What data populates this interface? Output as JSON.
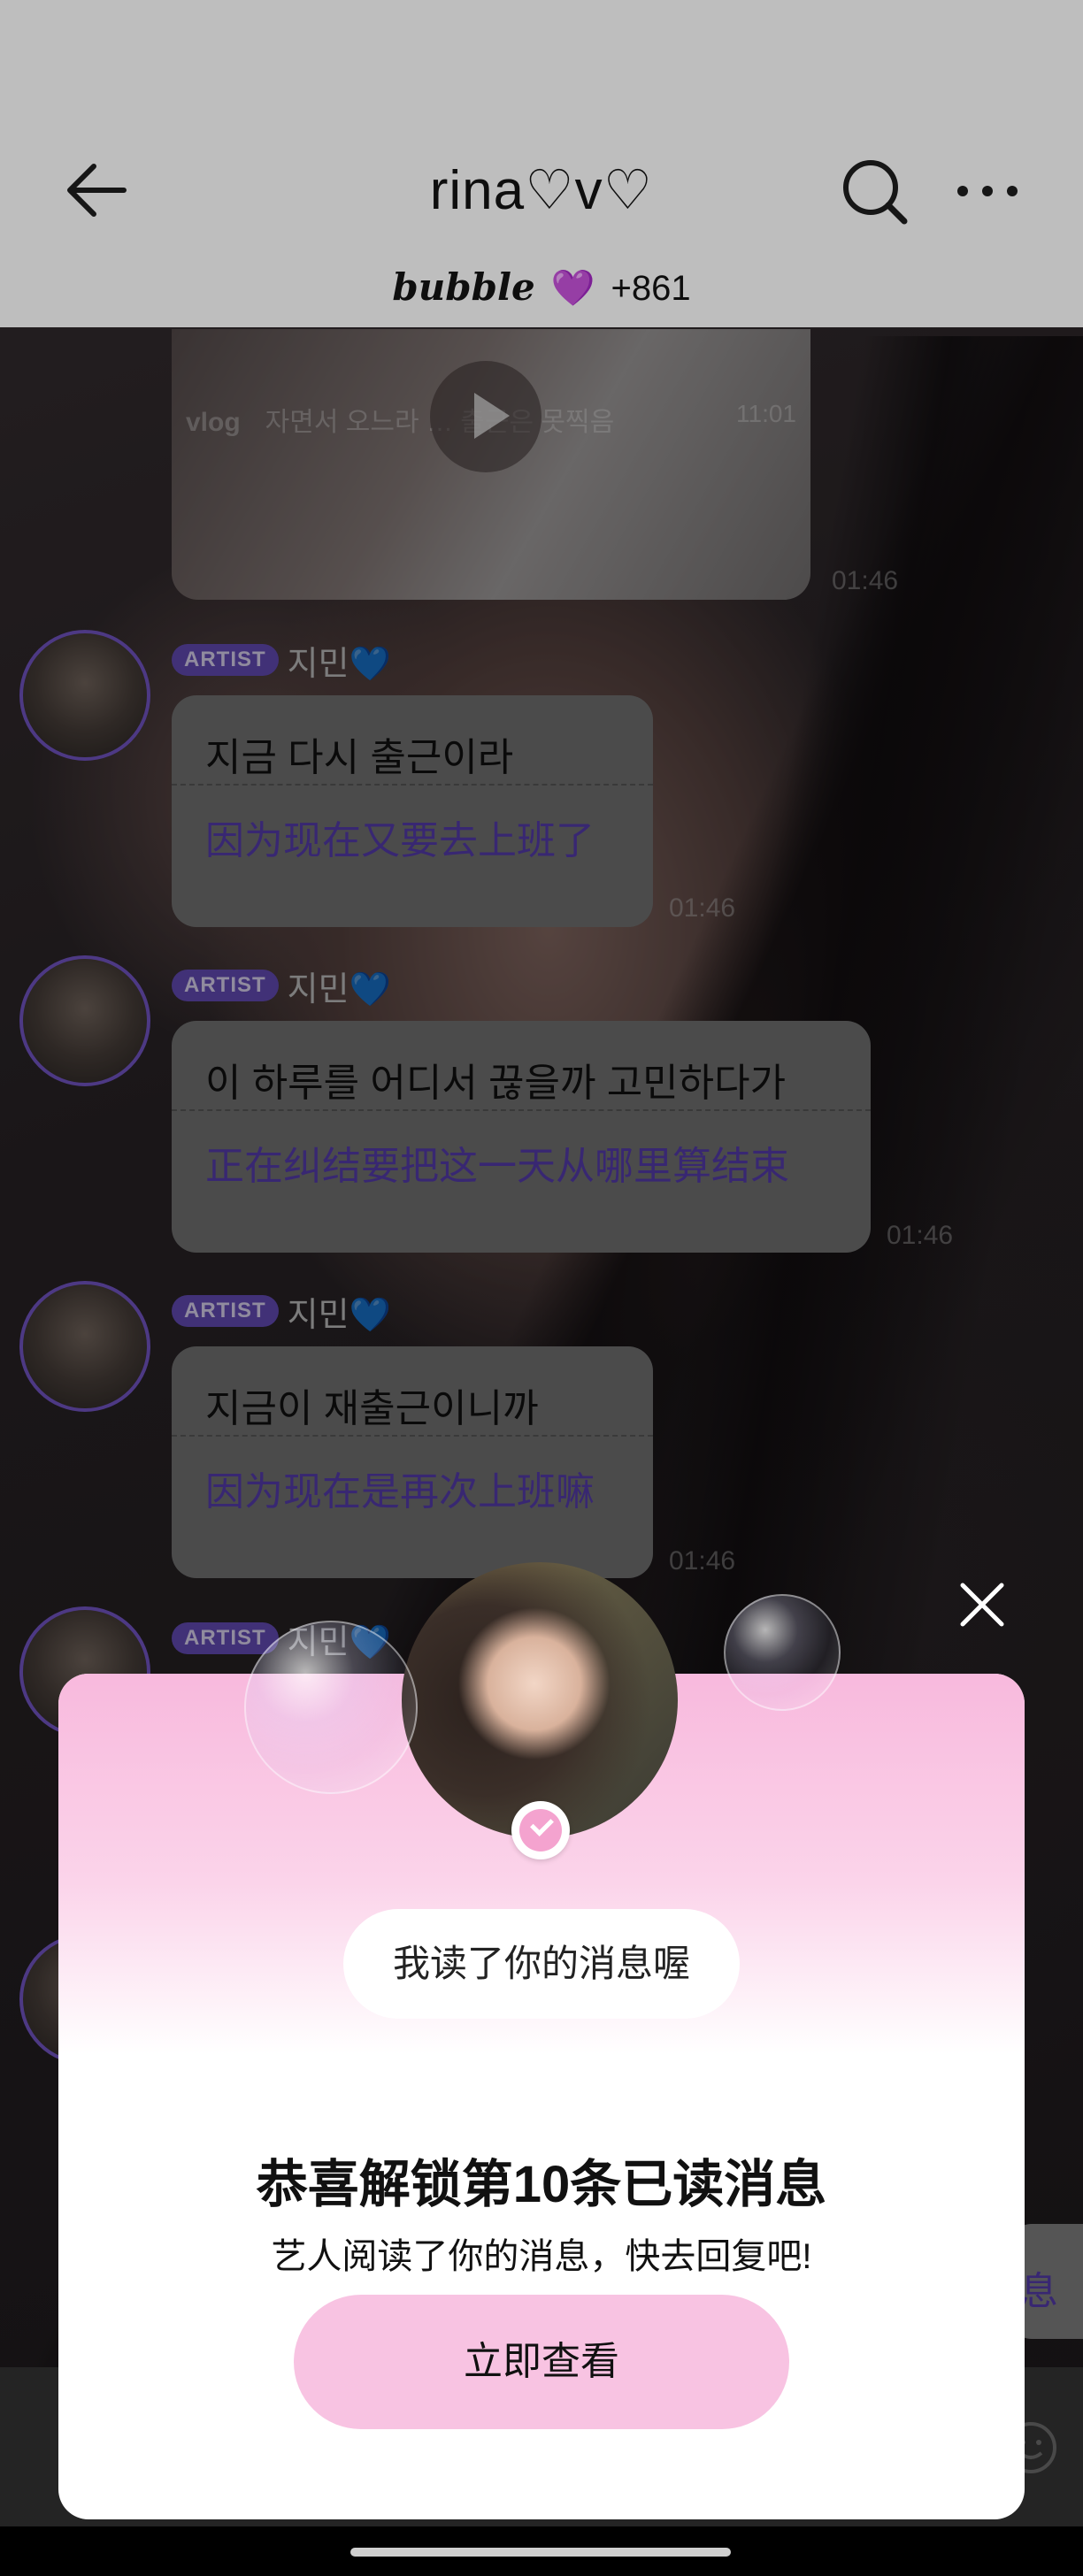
{
  "header": {
    "title": "rina♡v♡",
    "brand": "bubble",
    "heart": "💜",
    "subscriber_count": "+861"
  },
  "video": {
    "tag": "vlog",
    "caption": "자면서 오느라 … 출근은 못찍음",
    "duration": "11:01",
    "timestamp": "01:46"
  },
  "messages": [
    {
      "badge": "ARTIST",
      "sender": "지민",
      "sender_heart": "💙",
      "korean": "지금 다시 출근이라",
      "translation": "因为现在又要去上班了",
      "timestamp": "01:46"
    },
    {
      "badge": "ARTIST",
      "sender": "지민",
      "sender_heart": "💙",
      "korean": "이 하루를 어디서 끊을까 고민하다가",
      "translation": "正在纠结要把这一天从哪里算结束",
      "timestamp": "01:46"
    },
    {
      "badge": "ARTIST",
      "sender": "지민",
      "sender_heart": "💙",
      "korean": "지금이 재출근이니까",
      "translation": "因为现在是再次上班嘛",
      "timestamp": "01:46"
    },
    {
      "badge": "ARTIST",
      "sender": "지민",
      "sender_heart": "💙"
    }
  ],
  "partial_bubble_text": "息",
  "modal": {
    "read_notice": "我读了你的消息喔",
    "title": "恭喜解锁第10条已读消息",
    "subtitle": "艺人阅读了你的消息，快去回复吧!",
    "button_label": "立即查看"
  },
  "colors": {
    "accent": "#6a4fc0",
    "translation_text": "#5b3fb8",
    "modal_pink": "#f8c3e2"
  }
}
